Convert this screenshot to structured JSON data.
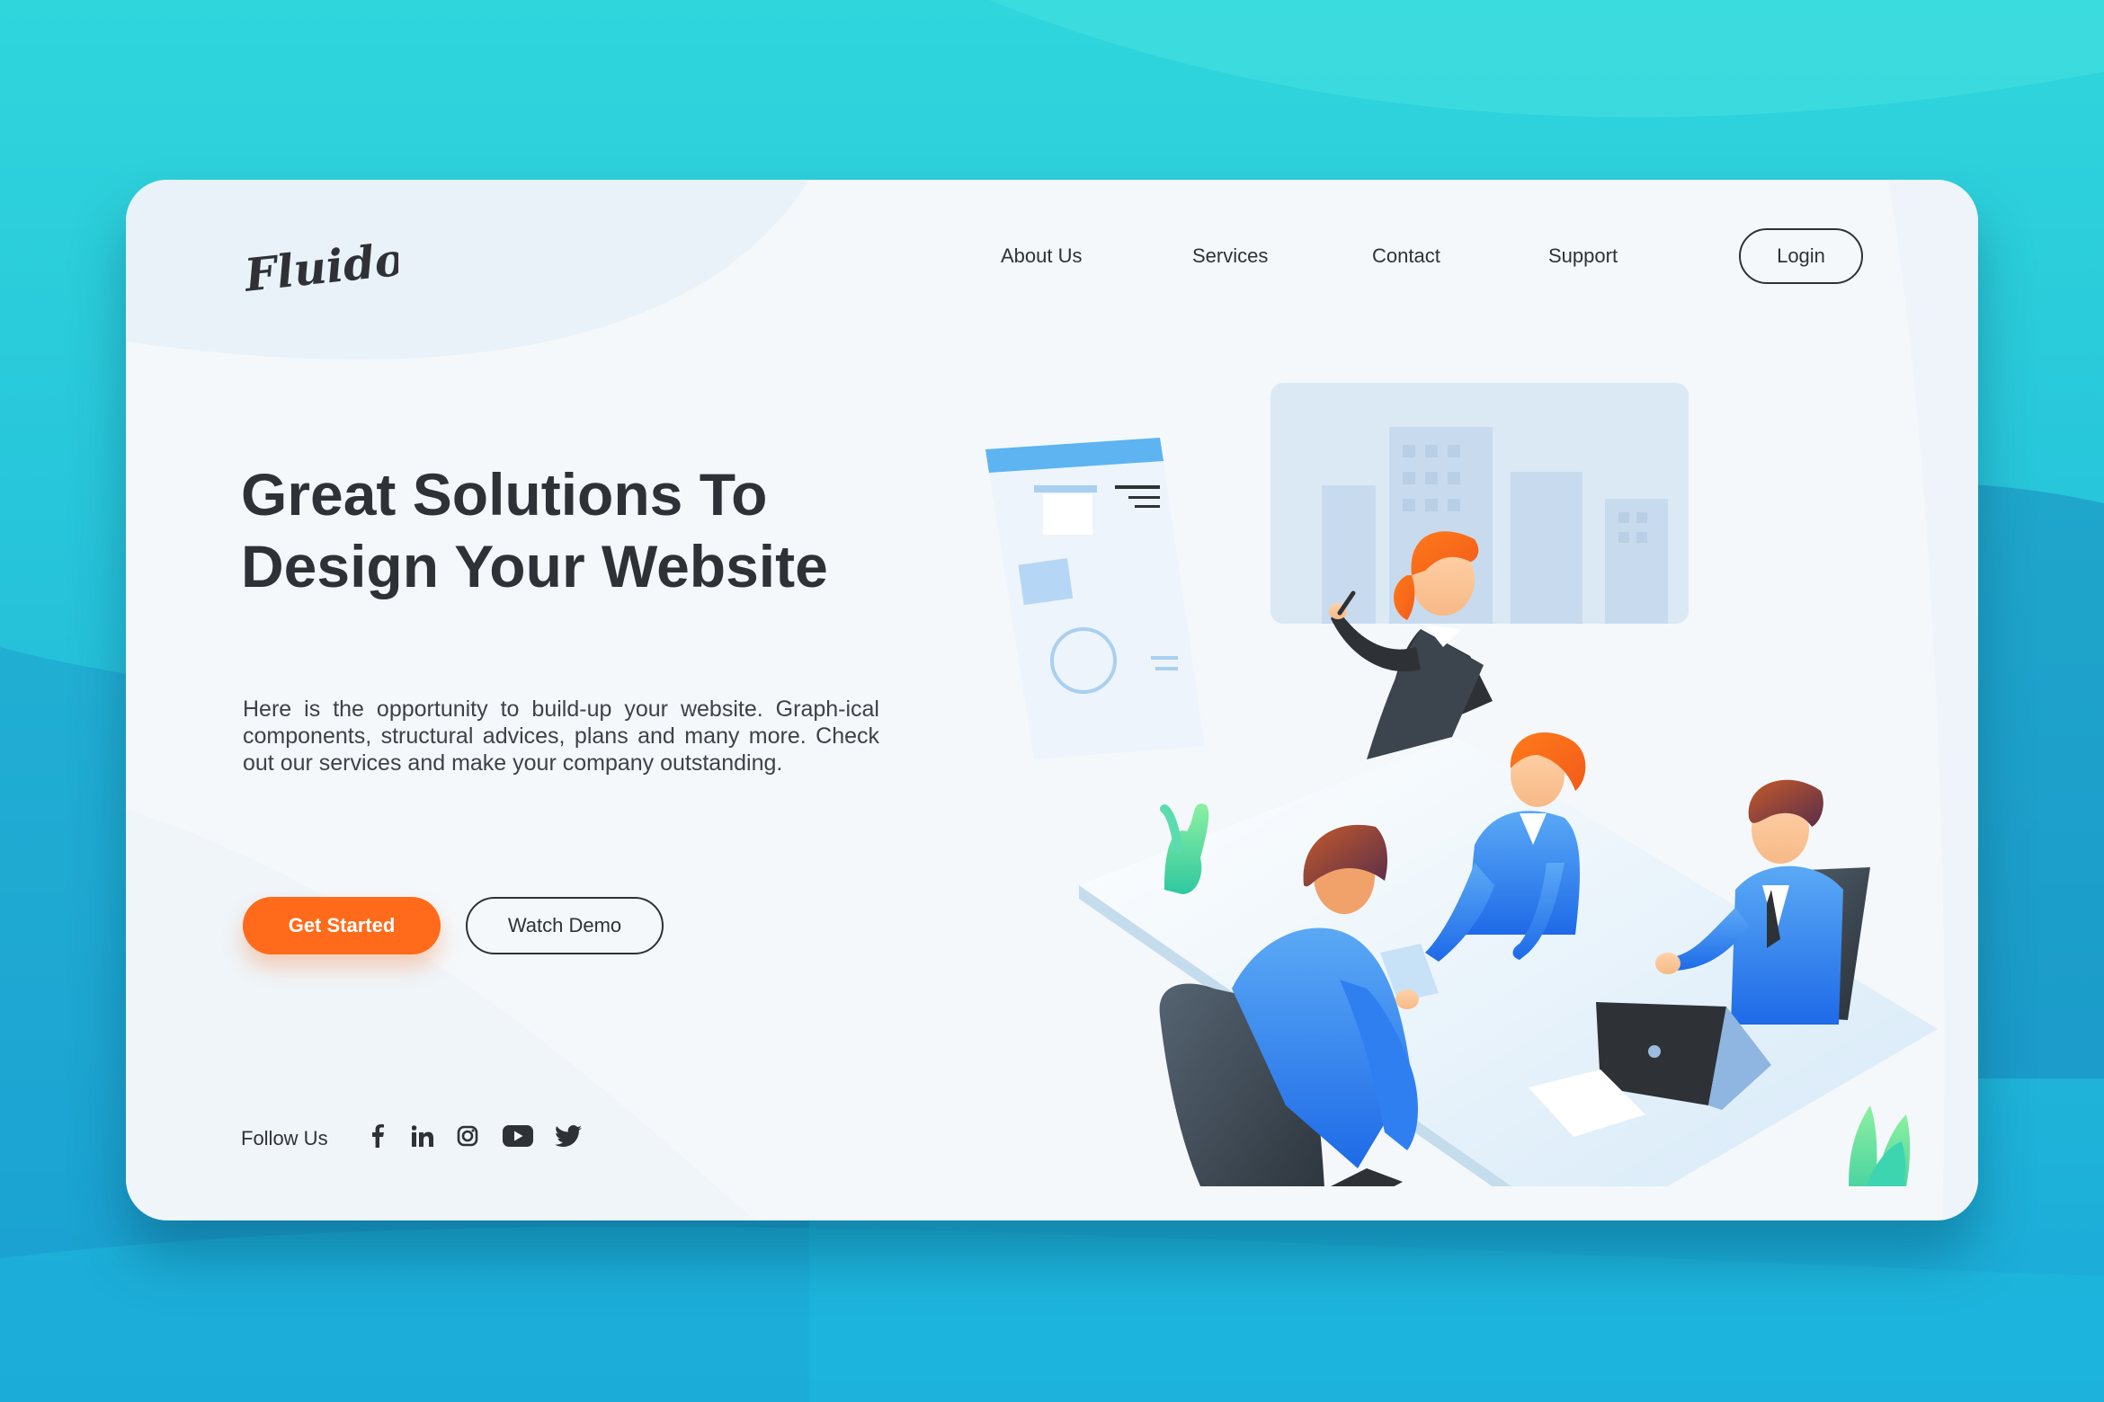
{
  "brand": {
    "logo_text": "Fluido"
  },
  "nav": {
    "items": [
      "About Us",
      "Services",
      "Contact",
      "Support"
    ],
    "login_label": "Login"
  },
  "hero": {
    "headline_line1": "Great Solutions To",
    "headline_line2": "Design Your Website",
    "description": "Here is the opportunity to build-up your website. Graph-ical components, structural advices, plans and many more. Check out our services and make your company outstanding.",
    "primary_button": "Get Started",
    "secondary_button": "Watch Demo"
  },
  "social": {
    "label": "Follow Us",
    "icons": [
      "facebook-icon",
      "linkedin-icon",
      "instagram-icon",
      "youtube-icon",
      "twitter-icon"
    ]
  },
  "colors": {
    "accent": "#ff6b1a",
    "text": "#2e3236",
    "background": "#1db9d6",
    "card": "#f4f8fb"
  }
}
